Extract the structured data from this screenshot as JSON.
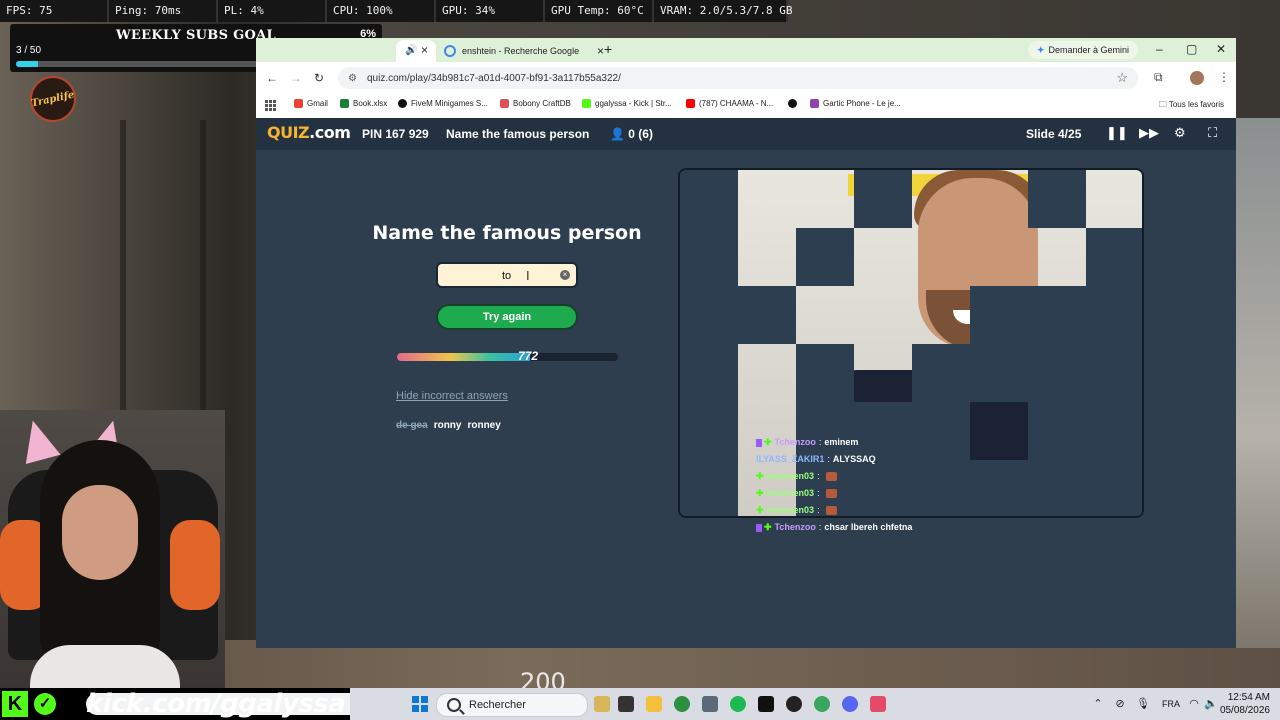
{
  "overlay": {
    "stats": [
      "FPS: 75",
      "Ping: 70ms",
      "PL: 4%",
      "CPU: 100%",
      "GPU: 34%",
      "GPU Temp: 60°C",
      "VRAM: 2.0/5.3/7.8 GB"
    ],
    "subs_goal": {
      "title": "WEEKLY SUBS GOAL",
      "percent": "6%",
      "count": "3 / 50",
      "progress": 0.06
    },
    "logo_text": "Traplife",
    "kick_url": "kick.com/ggalyssa"
  },
  "browser": {
    "tabs": [
      {
        "label": ""
      },
      {
        "label": "enshtein - Recherche Google"
      }
    ],
    "gemini_label": "Demander à Gemini",
    "url": "quiz.com/play/34b981c7-a01d-4007-bf91-3a117b55a322/",
    "bookmarks": [
      "Gmail",
      "Book.xlsx",
      "FiveM Minigames S...",
      "Bobony CraftDB",
      "ggalyssa - Kick | Str...",
      "(787) CHAAMA - N...",
      "",
      "Gartic Phone - Le je..."
    ],
    "all_bookmarks": "Tous les favoris"
  },
  "quiz": {
    "logo": {
      "q": "QUIZ",
      "rest": ".com"
    },
    "pin": "PIN 167 929",
    "name": "Name the famous person",
    "players": "0 (6)",
    "slide": "Slide 4/25",
    "question": "Name the famous person",
    "answer_value": "to",
    "try_again": "Try again",
    "timer_value": "772",
    "timer_fraction": 0.6,
    "hide_incorrect": "Hide incorrect answers",
    "wrong_answers": [
      {
        "text": "de gea",
        "struck": true
      },
      {
        "text": "ronny",
        "struck": false
      },
      {
        "text": "ronney",
        "struck": false
      }
    ]
  },
  "chat": [
    {
      "user": "Tchenzoo",
      "msg": "eminem",
      "color": "#c79bff",
      "badge": true
    },
    {
      "user": "ILYASS_ZAKIR1",
      "msg": "ALYSSAQ",
      "color": "#8fb6ff",
      "badge": false
    },
    {
      "user": "moomen03",
      "msg": "",
      "color": "#9cff7a",
      "badge": false,
      "emote": true
    },
    {
      "user": "moomen03",
      "msg": "",
      "color": "#9cff7a",
      "badge": false,
      "emote": true
    },
    {
      "user": "moomen03",
      "msg": "",
      "color": "#9cff7a",
      "badge": false,
      "emote": true
    },
    {
      "user": "Tchenzoo",
      "msg": "chsar lbereh chfetna",
      "color": "#c79bff",
      "badge": true
    }
  ],
  "taskbar": {
    "search_placeholder": "Rechercher",
    "lang": "FRA",
    "time": "12:54 AM",
    "date": "05/08/2026"
  },
  "game_hud": {
    "speed": "200"
  }
}
